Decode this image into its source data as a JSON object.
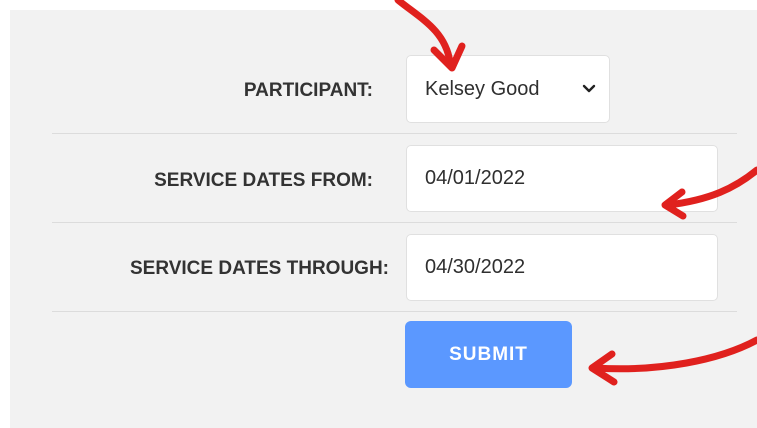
{
  "form": {
    "participant": {
      "label": "PARTICIPANT:",
      "selected": "Kelsey Good"
    },
    "service_dates_from": {
      "label": "SERVICE DATES FROM:",
      "value": "04/01/2022"
    },
    "service_dates_through": {
      "label": "SERVICE DATES THROUGH:",
      "value": "04/30/2022"
    },
    "submit_label": "SUBMIT"
  },
  "colors": {
    "panel_bg": "#f2f2f2",
    "submit_bg": "#5b98ff",
    "annotation_arrow": "#e0211e"
  }
}
